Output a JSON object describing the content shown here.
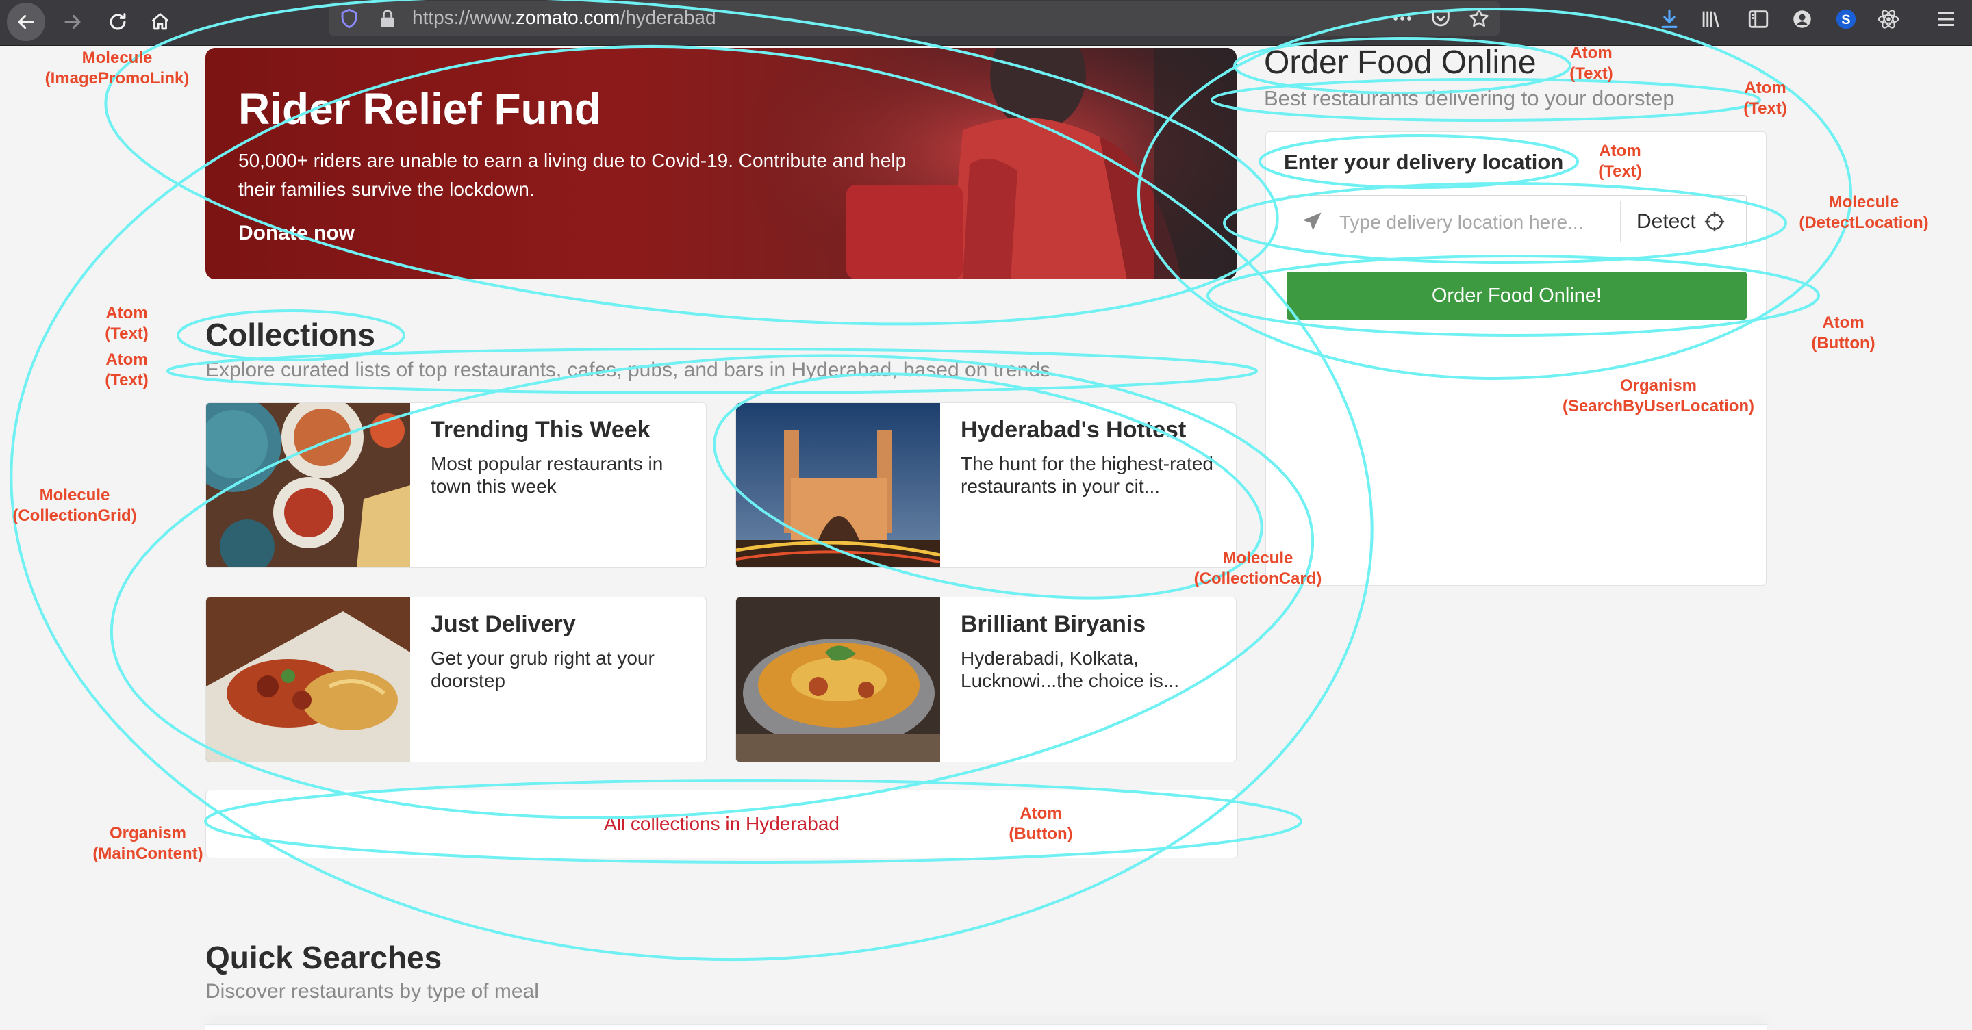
{
  "browser": {
    "url_prefix": "https://www.",
    "url_domain": "zomato.com",
    "url_path": "/hyderabad"
  },
  "promo": {
    "title": "Rider Relief Fund",
    "description": "50,000+ riders are unable to earn a living due to Covid-19. Contribute and help their families survive the lockdown.",
    "cta": "Donate now"
  },
  "collections": {
    "title": "Collections",
    "subtitle": "Explore curated lists of top restaurants, cafes, pubs, and bars in Hyderabad, based on trends",
    "cards": [
      {
        "title": "Trending This Week",
        "description": "Most popular restaurants in town this week"
      },
      {
        "title": "Hyderabad's Hottest",
        "description": "The hunt for the highest-rated restaurants in your cit..."
      },
      {
        "title": "Just Delivery",
        "description": "Get your grub right at your doorstep"
      },
      {
        "title": "Brilliant Biryanis",
        "description": "Hyderabadi, Kolkata, Lucknowi...the choice is..."
      }
    ],
    "all_button": "All collections in Hyderabad"
  },
  "order_online": {
    "title": "Order Food Online",
    "subtitle": "Best restaurants delivering to your doorstep",
    "location_label": "Enter your delivery location",
    "location_placeholder": "Type delivery location here...",
    "detect_label": "Detect",
    "button_label": "Order Food Online!"
  },
  "quick_searches": {
    "title": "Quick Searches",
    "subtitle": "Discover restaurants by type of meal"
  },
  "annotations": {
    "promo_link": {
      "kind": "Molecule",
      "type": "(ImagePromoLink)"
    },
    "collections_title": {
      "kind": "Atom",
      "type": "(Text)"
    },
    "collections_sub": {
      "kind": "Atom",
      "type": "(Text)"
    },
    "collection_grid": {
      "kind": "Molecule",
      "type": "(CollectionGrid)"
    },
    "main_content": {
      "kind": "Organism",
      "type": "(MainContent)"
    },
    "order_title": {
      "kind": "Atom",
      "type": "(Text)"
    },
    "order_sub": {
      "kind": "Atom",
      "type": "(Text)"
    },
    "location_label": {
      "kind": "Atom",
      "type": "(Text)"
    },
    "detect_location": {
      "kind": "Molecule",
      "type": "(DetectLocation)"
    },
    "order_button": {
      "kind": "Atom",
      "type": "(Button)"
    },
    "search_by_location": {
      "kind": "Organism",
      "type": "(SearchByUserLocation)"
    },
    "collection_card": {
      "kind": "Molecule",
      "type": "(CollectionCard)"
    },
    "all_button": {
      "kind": "Atom",
      "type": "(Button)"
    }
  },
  "colors": {
    "brand_red": "#cb202d",
    "order_green": "#3d9a40",
    "annotation_cyan": "#6ff0f2",
    "annotation_label": "#e8492b"
  }
}
